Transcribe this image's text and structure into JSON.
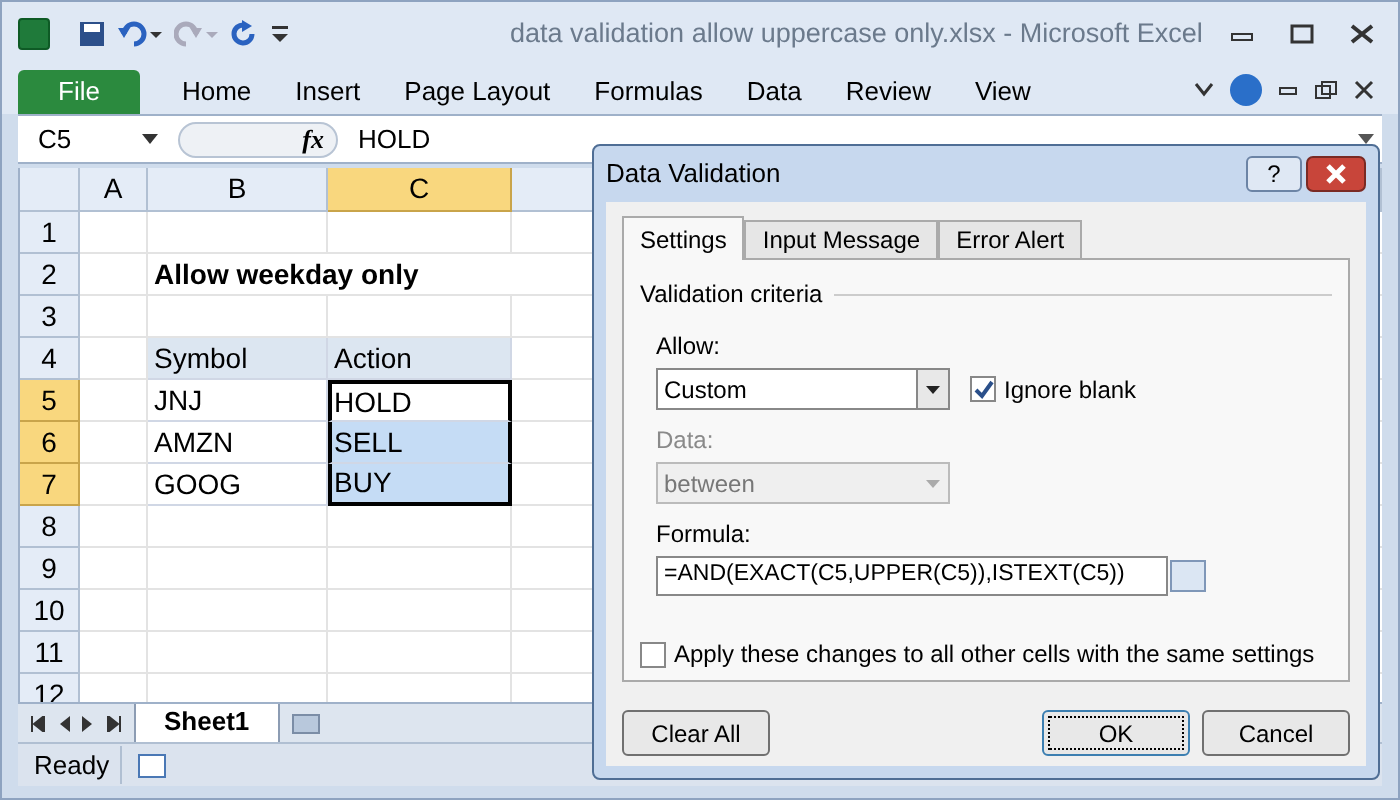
{
  "window": {
    "title": "data validation allow uppercase only.xlsx  -  Microsoft Excel"
  },
  "ribbon_tabs": [
    {
      "label": "File",
      "kind": "file",
      "selected": false
    },
    {
      "label": "Home",
      "kind": "tab",
      "selected": false
    },
    {
      "label": "Insert",
      "kind": "tab",
      "selected": false
    },
    {
      "label": "Page Layout",
      "kind": "tab",
      "selected": false
    },
    {
      "label": "Formulas",
      "kind": "tab",
      "selected": false
    },
    {
      "label": "Data",
      "kind": "tab",
      "selected": false
    },
    {
      "label": "Review",
      "kind": "tab",
      "selected": false
    },
    {
      "label": "View",
      "kind": "tab",
      "selected": false
    }
  ],
  "formula_bar": {
    "name_box": "C5",
    "fx": "fx",
    "formula": "HOLD"
  },
  "sheet": {
    "columns": [
      {
        "label": "A",
        "selected": false
      },
      {
        "label": "B",
        "selected": false
      },
      {
        "label": "C",
        "selected": true
      }
    ],
    "rows": [
      {
        "label": "1",
        "selected": false
      },
      {
        "label": "2",
        "selected": false
      },
      {
        "label": "3",
        "selected": false
      },
      {
        "label": "4",
        "selected": false
      },
      {
        "label": "5",
        "selected": true
      },
      {
        "label": "6",
        "selected": true
      },
      {
        "label": "7",
        "selected": true
      },
      {
        "label": "8",
        "selected": false
      },
      {
        "label": "9",
        "selected": false
      },
      {
        "label": "10",
        "selected": false
      },
      {
        "label": "11",
        "selected": false
      },
      {
        "label": "12",
        "selected": false
      }
    ],
    "heading": "Allow weekday only",
    "table": {
      "columns": [
        "Symbol",
        "Action"
      ],
      "rows": [
        {
          "symbol": "JNJ",
          "action": "HOLD",
          "selected": false
        },
        {
          "symbol": "AMZN",
          "action": "SELL",
          "selected": true
        },
        {
          "symbol": "GOOG",
          "action": "BUY",
          "selected": true
        }
      ]
    }
  },
  "sheet_tabs": [
    {
      "label": "Sheet1",
      "selected": true
    }
  ],
  "status_bar": {
    "text": "Ready"
  },
  "dialog": {
    "title": "Data Validation",
    "help": "?",
    "tabs": [
      {
        "label": "Settings",
        "selected": true
      },
      {
        "label": "Input Message",
        "selected": false
      },
      {
        "label": "Error Alert",
        "selected": false
      }
    ],
    "section": "Validation criteria",
    "allow": {
      "label": "Allow:",
      "value": "Custom"
    },
    "ignore_blank": {
      "label": "Ignore blank",
      "checked": true
    },
    "data": {
      "label": "Data:",
      "value": "between",
      "disabled": true
    },
    "formula": {
      "label": "Formula:",
      "value": "=AND(EXACT(C5,UPPER(C5)),ISTEXT(C5))"
    },
    "apply_all": {
      "label": "Apply these changes to all other cells with the same settings",
      "checked": false
    },
    "buttons": [
      {
        "label": "Clear All",
        "kind": "left",
        "default": false
      },
      {
        "label": "OK",
        "kind": "right",
        "default": true
      },
      {
        "label": "Cancel",
        "kind": "right",
        "default": false
      }
    ]
  }
}
